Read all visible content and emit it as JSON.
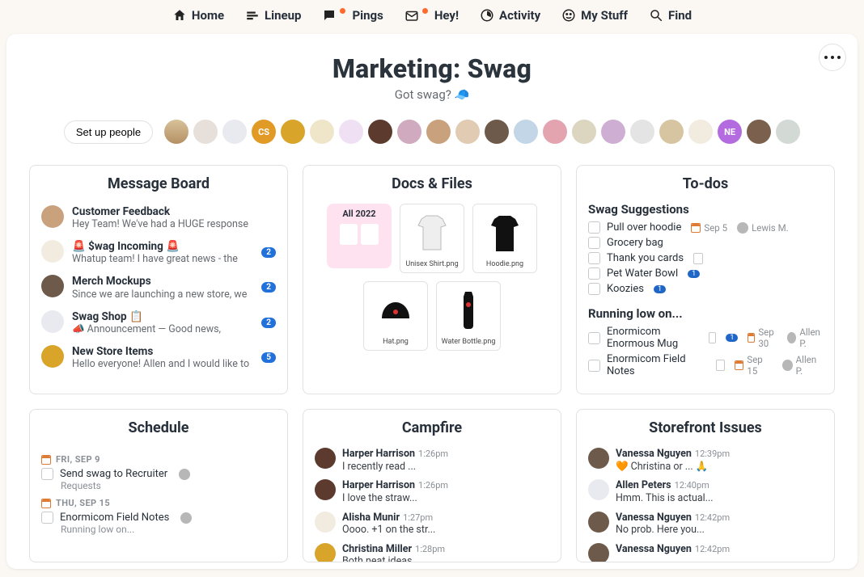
{
  "nav": {
    "home": "Home",
    "lineup": "Lineup",
    "pings": "Pings",
    "hey": "Hey!",
    "activity": "Activity",
    "mystuff": "My Stuff",
    "find": "Find"
  },
  "project": {
    "title": "Marketing: Swag",
    "subtitle": "Got swag? 🧢",
    "setup_people": "Set up people"
  },
  "people": [
    {
      "label": "",
      "cls": "c0"
    },
    {
      "label": "",
      "cls": "c1"
    },
    {
      "label": "",
      "cls": "c2"
    },
    {
      "label": "CS",
      "cls": "c3"
    },
    {
      "label": "",
      "cls": "c4"
    },
    {
      "label": "",
      "cls": "c5"
    },
    {
      "label": "",
      "cls": "c6"
    },
    {
      "label": "",
      "cls": "c7"
    },
    {
      "label": "",
      "cls": "c8"
    },
    {
      "label": "",
      "cls": "c9"
    },
    {
      "label": "",
      "cls": "c10"
    },
    {
      "label": "",
      "cls": "c11"
    },
    {
      "label": "",
      "cls": "c12"
    },
    {
      "label": "",
      "cls": "c13"
    },
    {
      "label": "",
      "cls": "c14"
    },
    {
      "label": "",
      "cls": "c15"
    },
    {
      "label": "",
      "cls": "c16"
    },
    {
      "label": "",
      "cls": "c17"
    },
    {
      "label": "",
      "cls": "c18"
    },
    {
      "label": "NE",
      "cls": "c19"
    },
    {
      "label": "",
      "cls": "c20"
    },
    {
      "label": "",
      "cls": "c21"
    }
  ],
  "cards": {
    "message_board": {
      "title": "Message Board",
      "items": [
        {
          "title": "Customer Feedback",
          "snippet": "Hey Team! We've had a HUGE response",
          "count": "",
          "ava": "c9"
        },
        {
          "title": "🚨 $wag Incoming 🚨",
          "snippet": "Whatup team! I have great news - the",
          "count": "2",
          "ava": "c18"
        },
        {
          "title": "Merch Mockups",
          "snippet": "Since we are launching a new store, we",
          "count": "2",
          "ava": "c11"
        },
        {
          "title": "Swag Shop 📋",
          "snippet": "📣 Announcement — Good news,",
          "count": "2",
          "ava": "c2"
        },
        {
          "title": "New Store Items",
          "snippet": "Hello everyone! Allen and I would like to",
          "count": "5",
          "ava": "c4"
        }
      ]
    },
    "docs": {
      "title": "Docs & Files",
      "folder": "All 2022",
      "files": [
        {
          "name": "Unisex Shirt.png",
          "color": "#f4f4f4"
        },
        {
          "name": "Hoodie.png",
          "color": "#111"
        },
        {
          "name": "Hat.png",
          "color": "#111"
        },
        {
          "name": "Water Bottle.png",
          "color": "#111"
        }
      ]
    },
    "todos": {
      "title": "To-dos",
      "lists": [
        {
          "name": "Swag Suggestions",
          "items": [
            {
              "label": "Pull over hoodie",
              "date": "Sep 5",
              "assignee": "Lewis M.",
              "doc": false,
              "count": ""
            },
            {
              "label": "Grocery bag",
              "date": "",
              "assignee": "",
              "doc": false,
              "count": ""
            },
            {
              "label": "Thank you cards",
              "date": "",
              "assignee": "",
              "doc": true,
              "count": ""
            },
            {
              "label": "Pet Water Bowl",
              "date": "",
              "assignee": "",
              "doc": false,
              "count": "1"
            },
            {
              "label": "Koozies",
              "date": "",
              "assignee": "",
              "doc": false,
              "count": "1"
            }
          ]
        },
        {
          "name": "Running low on...",
          "items": [
            {
              "label": "Enormicom Enormous Mug",
              "date": "Sep 30",
              "assignee": "Allen P.",
              "doc": true,
              "count": "1"
            },
            {
              "label": "Enormicom Field Notes",
              "date": "Sep 15",
              "assignee": "Allen P.",
              "doc": true,
              "count": ""
            }
          ]
        }
      ]
    },
    "schedule": {
      "title": "Schedule",
      "days": [
        {
          "date": "FRI, SEP 9",
          "item": "Send swag to Recruiter",
          "sub": "Requests"
        },
        {
          "date": "THU, SEP 15",
          "item": "Enormicom Field Notes",
          "sub": "Running low on..."
        }
      ]
    },
    "campfire": {
      "title": "Campfire",
      "msgs": [
        {
          "name": "Harper Harrison",
          "time": "1:26pm",
          "snippet": "I recently read ...",
          "ava": "c7"
        },
        {
          "name": "Harper Harrison",
          "time": "1:26pm",
          "snippet": "I love the straw...",
          "ava": "c7"
        },
        {
          "name": "Alisha Munir",
          "time": "1:27pm",
          "snippet": "Oooo. +1 on the str...",
          "ava": "c18"
        },
        {
          "name": "Christina Miller",
          "time": "1:28pm",
          "snippet": "Both neat ideas....",
          "ava": "c4"
        }
      ]
    },
    "storefront": {
      "title": "Storefront Issues",
      "msgs": [
        {
          "name": "Vanessa Nguyen",
          "time": "12:39pm",
          "snippet": "🧡 Christina or ... 🙏",
          "ava": "c11"
        },
        {
          "name": "Allen Peters",
          "time": "12:40pm",
          "snippet": "Hmm. This is actual...",
          "ava": "c2"
        },
        {
          "name": "Vanessa Nguyen",
          "time": "12:42pm",
          "snippet": "No prob. Here you...",
          "ava": "c11"
        },
        {
          "name": "Vanessa Nguyen",
          "time": "12:42pm",
          "snippet": "",
          "ava": "c11"
        }
      ]
    }
  }
}
